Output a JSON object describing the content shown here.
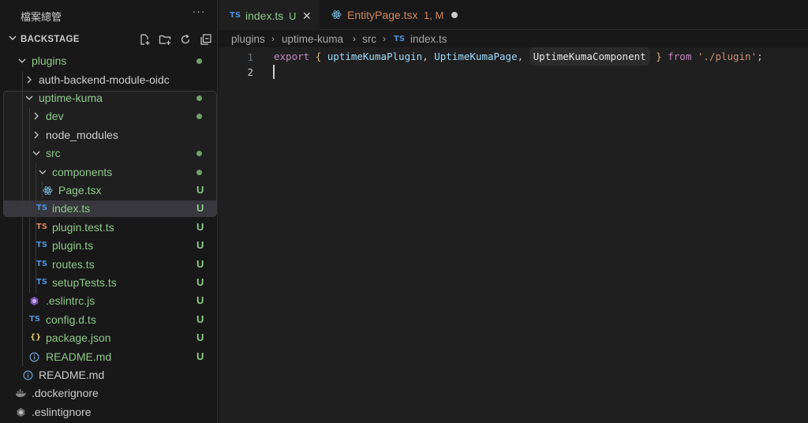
{
  "sidebar": {
    "title": "檔案總管",
    "more": "···",
    "section_title": "BACKSTAGE"
  },
  "tree": [
    {
      "label": "plugins",
      "status": "dot"
    },
    {
      "label": "auth-backend-module-oidc",
      "status": ""
    },
    {
      "label": "uptime-kuma",
      "status": "dot"
    },
    {
      "label": "dev",
      "status": "dot"
    },
    {
      "label": "node_modules",
      "status": ""
    },
    {
      "label": "src",
      "status": "dot"
    },
    {
      "label": "components",
      "status": "dot"
    },
    {
      "label": "Page.tsx",
      "status": "U"
    },
    {
      "label": "index.ts",
      "status": "U",
      "icon": "TS"
    },
    {
      "label": "plugin.test.ts",
      "status": "U",
      "icon": "TS"
    },
    {
      "label": "plugin.ts",
      "status": "U",
      "icon": "TS"
    },
    {
      "label": "routes.ts",
      "status": "U",
      "icon": "TS"
    },
    {
      "label": "setupTests.ts",
      "status": "U",
      "icon": "TS"
    },
    {
      "label": ".eslintrc.js",
      "status": "U"
    },
    {
      "label": "config.d.ts",
      "status": "U",
      "icon": "TS"
    },
    {
      "label": "package.json",
      "status": "U",
      "icon": "{}"
    },
    {
      "label": "README.md",
      "status": "U"
    },
    {
      "label": "README.md",
      "status": ""
    },
    {
      "label": ".dockerignore",
      "status": ""
    },
    {
      "label": ".eslintignore",
      "status": ""
    }
  ],
  "tabs": [
    {
      "icon": "TS",
      "name": "index.ts",
      "mod": "U",
      "close": "✕"
    },
    {
      "name": "EntityPage.tsx",
      "mod": "1, M"
    }
  ],
  "breadcrumb": {
    "parts": [
      "plugins",
      "uptime-kuma",
      "src",
      "index.ts"
    ],
    "icon": "TS"
  },
  "editor": {
    "line_numbers": [
      "1",
      "2"
    ],
    "code": {
      "kw_export": "export",
      "brace_open": "{",
      "name1": "uptimeKumaPlugin",
      "comma1": ",",
      "name2": "UptimeKumaPage",
      "comma2": ",",
      "name3": "UptimeKumaComponent",
      "brace_close": "}",
      "kw_from": "from",
      "path": "'./plugin'",
      "semi": ";"
    }
  },
  "colors": {
    "git_untracked": "#8fc98a",
    "git_modified": "#d4875a",
    "ts_icon": "#4d8fd8"
  }
}
